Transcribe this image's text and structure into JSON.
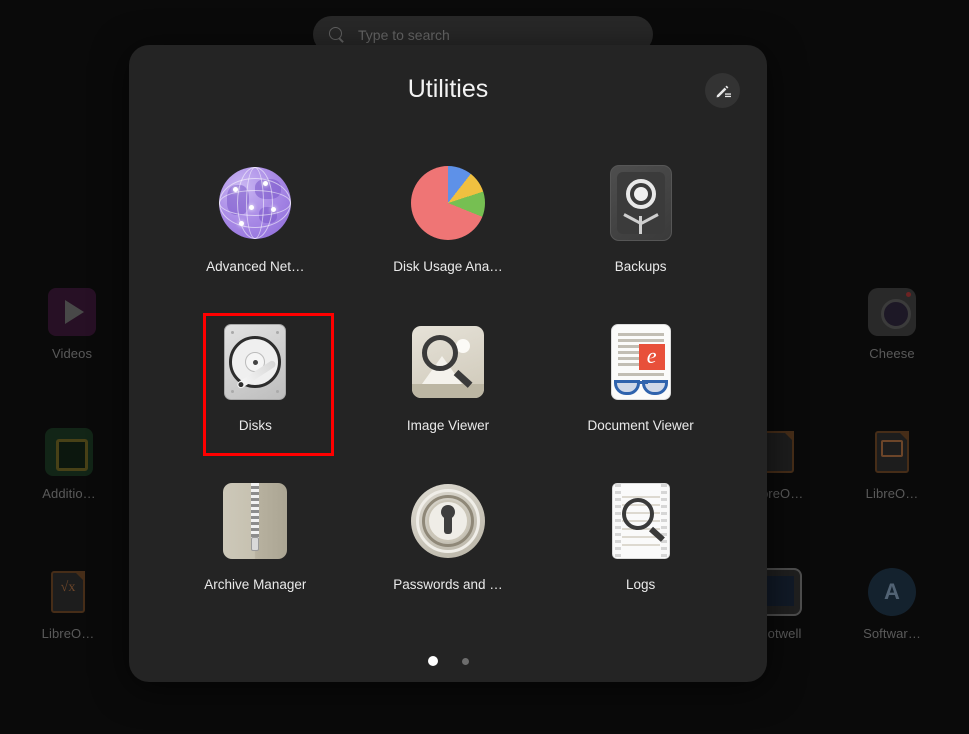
{
  "search": {
    "placeholder": "Type to search",
    "icon": "search-icon"
  },
  "folder": {
    "title": "Utilities",
    "edit_icon": "edit-pencil-icon",
    "apps": [
      {
        "label": "Advanced Net…",
        "icon": "advanced-network-configuration-icon"
      },
      {
        "label": "Disk Usage Ana…",
        "icon": "disk-usage-analyzer-icon"
      },
      {
        "label": "Backups",
        "icon": "backups-icon"
      },
      {
        "label": "Disks",
        "icon": "disks-icon"
      },
      {
        "label": "Image Viewer",
        "icon": "image-viewer-icon"
      },
      {
        "label": "Document Viewer",
        "icon": "document-viewer-icon"
      },
      {
        "label": "Archive Manager",
        "icon": "archive-manager-icon"
      },
      {
        "label": "Passwords and …",
        "icon": "passwords-and-keys-icon"
      },
      {
        "label": "Logs",
        "icon": "logs-icon"
      }
    ],
    "pages": {
      "count": 2,
      "active": 1
    },
    "highlight": {
      "target": "Disks",
      "color": "#ff0000"
    }
  },
  "desktop": {
    "icons": [
      {
        "label": "Videos",
        "icon": "videos-icon"
      },
      {
        "label": "Cheese",
        "icon": "cheese-icon"
      },
      {
        "label": "Additio…",
        "icon": "additional-drivers-icon"
      },
      {
        "label": "LibreO…",
        "icon": "libreoffice-draw-icon"
      },
      {
        "label": "LibreO…",
        "icon": "libreoffice-impress-icon"
      },
      {
        "label": "LibreO…",
        "icon": "libreoffice-math-icon"
      },
      {
        "label": "…otwell",
        "icon": "shotwell-icon"
      },
      {
        "label": "Softwar…",
        "icon": "software-icon"
      }
    ]
  },
  "colors": {
    "panel": "#242424",
    "background": "#0a0a0a",
    "accent_highlight": "#ff0000",
    "label_text": "#eaeaea"
  }
}
